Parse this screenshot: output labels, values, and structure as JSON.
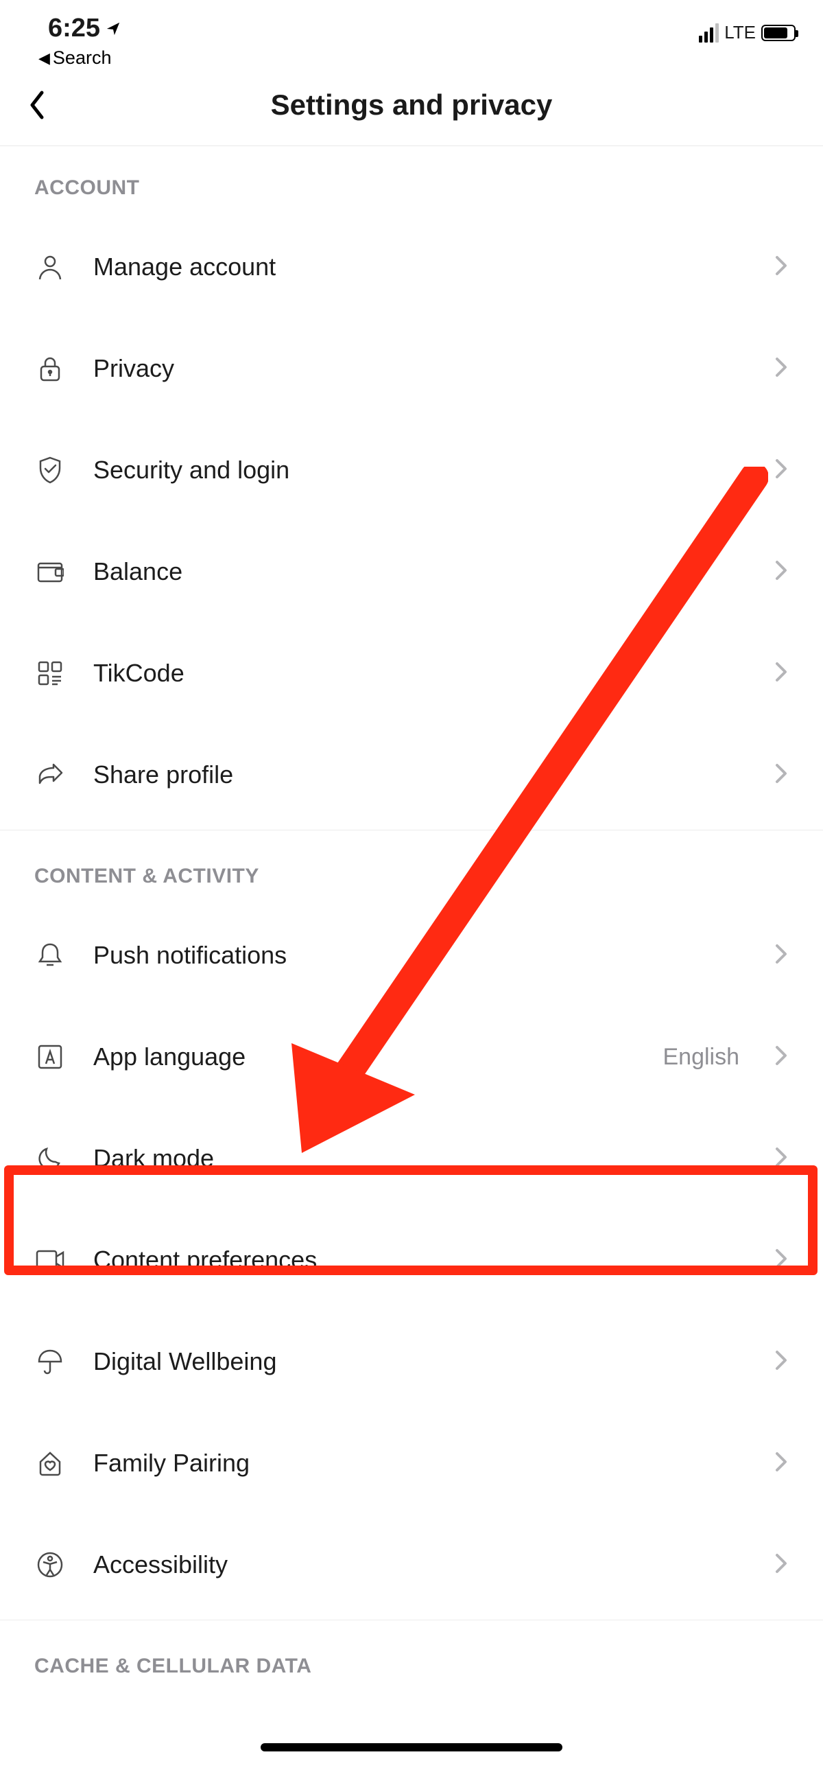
{
  "status": {
    "time": "6:25",
    "back_label": "Search",
    "network": "LTE"
  },
  "header": {
    "title": "Settings and privacy"
  },
  "sections": {
    "account": {
      "title": "ACCOUNT",
      "items": {
        "manage_account": "Manage account",
        "privacy": "Privacy",
        "security": "Security and login",
        "balance": "Balance",
        "tikcode": "TikCode",
        "share_profile": "Share profile"
      }
    },
    "content_activity": {
      "title": "CONTENT & ACTIVITY",
      "items": {
        "push_notifications": "Push notifications",
        "app_language": "App language",
        "app_language_value": "English",
        "dark_mode": "Dark mode",
        "content_preferences": "Content preferences",
        "digital_wellbeing": "Digital Wellbeing",
        "family_pairing": "Family Pairing",
        "accessibility": "Accessibility"
      }
    },
    "cache": {
      "title": "CACHE & CELLULAR DATA"
    }
  }
}
